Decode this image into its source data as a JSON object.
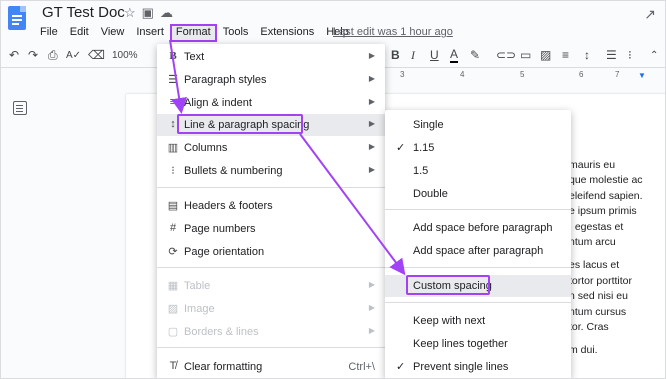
{
  "app": {
    "doc_title": "GT Test Doc",
    "last_edit": "Last edit was 1 hour ago"
  },
  "menubar": {
    "items": [
      "File",
      "Edit",
      "View",
      "Insert",
      "Format",
      "Tools",
      "Extensions",
      "Help"
    ],
    "active": "Format"
  },
  "toolbar": {
    "zoom": "100%"
  },
  "ruler": {
    "ticks": [
      "3",
      "4",
      "5",
      "6",
      "7"
    ]
  },
  "format_menu": {
    "text": "Text",
    "paragraph_styles": "Paragraph styles",
    "align_indent": "Align & indent",
    "line_spacing": "Line & paragraph spacing",
    "columns": "Columns",
    "bullets": "Bullets & numbering",
    "headers_footers": "Headers & footers",
    "page_numbers": "Page numbers",
    "page_orientation": "Page orientation",
    "table": "Table",
    "image": "Image",
    "borders_lines": "Borders & lines",
    "clear_formatting": "Clear formatting",
    "clear_shortcut": "Ctrl+\\"
  },
  "spacing_submenu": {
    "single": "Single",
    "one_fifteen": "1.15",
    "one_five": "1.5",
    "double": "Double",
    "checked": "1.15",
    "add_before": "Add space before paragraph",
    "add_after": "Add space after paragraph",
    "custom": "Custom spacing",
    "keep_next": "Keep with next",
    "keep_together": "Keep lines together",
    "prevent_single": "Prevent single lines"
  },
  "document": {
    "lines": [
      "mauris eu",
      "que molestie ac",
      "eleifend sapien.",
      "e ipsum primis",
      "; egestas et",
      "ntum arcu",
      "",
      "es lacus et",
      "tortor porttitor",
      "n sed nisi eu",
      "ntum cursus",
      "tor. Cras",
      "",
      "m dui."
    ]
  },
  "colors": {
    "highlight_purple": "#a142f4",
    "doc_blue": "#4285f4"
  }
}
